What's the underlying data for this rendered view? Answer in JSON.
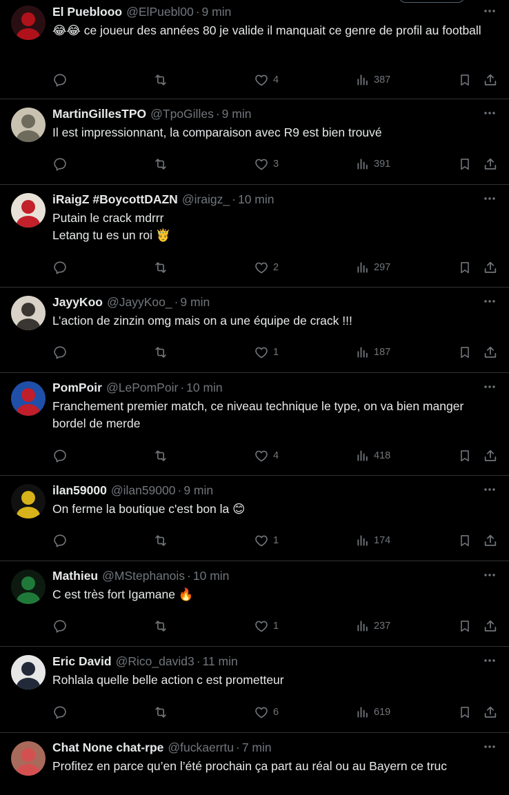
{
  "tweets": [
    {
      "name": "El Pueblooo",
      "handle": "@ElPuebl00",
      "time": "9 min",
      "text": "😂😂 ce joueur des années 80 je valide il manquait ce genre de profil au football",
      "replies": "",
      "retweets": "",
      "likes": "4",
      "views": "387",
      "avatar_colors": [
        "#2a0f12",
        "#b0121b"
      ]
    },
    {
      "name": "MartinGillesTPO",
      "handle": "@TpoGilles",
      "time": "9 min",
      "text": "Il est impressionnant, la comparaison avec R9 est bien trouvé",
      "replies": "",
      "retweets": "",
      "likes": "3",
      "views": "391",
      "avatar_colors": [
        "#c9c2b0",
        "#6e6a5c"
      ]
    },
    {
      "name": "iRaigZ #BoycottDAZN",
      "handle": "@iraigz_",
      "time": "10 min",
      "text": "Putain le crack mdrrr\nLetang tu es un roi 🤴",
      "replies": "",
      "retweets": "",
      "likes": "2",
      "views": "297",
      "avatar_colors": [
        "#e8e1d8",
        "#c2202a"
      ]
    },
    {
      "name": "JayyKoo",
      "handle": "@JayyKoo_",
      "time": "9 min",
      "text": "L’action de zinzin omg mais on a une équipe de crack !!!",
      "replies": "",
      "retweets": "",
      "likes": "1",
      "views": "187",
      "avatar_colors": [
        "#d9d2c8",
        "#3a3632"
      ]
    },
    {
      "name": "PomPoir",
      "handle": "@LePomPoir",
      "time": "10 min",
      "text": "Franchement premier match, ce niveau technique le type, on va bien manger bordel de merde",
      "replies": "",
      "retweets": "",
      "likes": "4",
      "views": "418",
      "avatar_colors": [
        "#1f4fa8",
        "#c01e2a"
      ]
    },
    {
      "name": "ilan59000",
      "handle": "@ilan59000",
      "time": "9 min",
      "text": "On ferme la boutique c'est bon la 😊",
      "replies": "",
      "retweets": "",
      "likes": "1",
      "views": "174",
      "avatar_colors": [
        "#111111",
        "#d8b21a"
      ]
    },
    {
      "name": "Mathieu",
      "handle": "@MStephanois",
      "time": "10 min",
      "text": "C est très fort Igamane 🔥",
      "replies": "",
      "retweets": "",
      "likes": "1",
      "views": "237",
      "avatar_colors": [
        "#0d1a10",
        "#1f7a3a"
      ]
    },
    {
      "name": "Eric David",
      "handle": "@Rico_david3",
      "time": "11 min",
      "text": "Rohlala quelle belle action c est prometteur",
      "replies": "",
      "retweets": "",
      "likes": "6",
      "views": "619",
      "avatar_colors": [
        "#e7e7e7",
        "#222a3a"
      ]
    },
    {
      "name": "Chat None chat-rpe",
      "handle": "@fuckaerrtu",
      "time": "7 min",
      "text": "Profitez en parce qu’en l’été prochain ça part au réal ou au Bayern ce truc",
      "replies": "",
      "retweets": "",
      "likes": "",
      "views": "",
      "avatar_colors": [
        "#a86a5a",
        "#d45050"
      ]
    }
  ]
}
